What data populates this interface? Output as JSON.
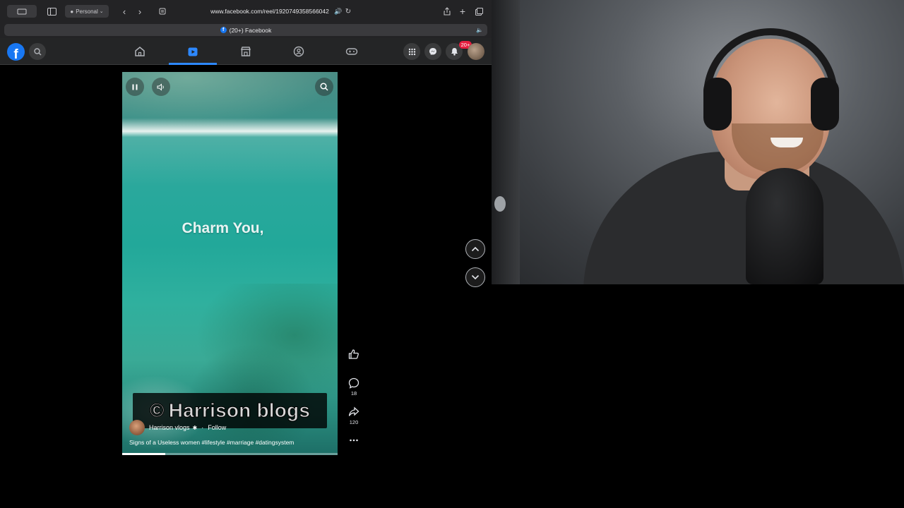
{
  "browser": {
    "profile_label": "Personal",
    "url": "www.facebook.com/reel/1920749358566042",
    "tab_title": "(20+) Facebook"
  },
  "fb_nav": {
    "notification_badge": "20+"
  },
  "reel": {
    "overlay_text": "Charm You,",
    "watermark_text": "Harrison blogs",
    "author_name": "Harrison vlogs",
    "follow_label": "Follow",
    "caption": "Signs of a Useless women #lifestyle #marriage #datingsystem",
    "progress_percent": 20
  },
  "actions": {
    "comment_count": "18",
    "share_count": "120"
  },
  "colors": {
    "fb_blue": "#1877f2",
    "active_tab": "#2d88ff",
    "badge_red": "#e41e3f"
  }
}
